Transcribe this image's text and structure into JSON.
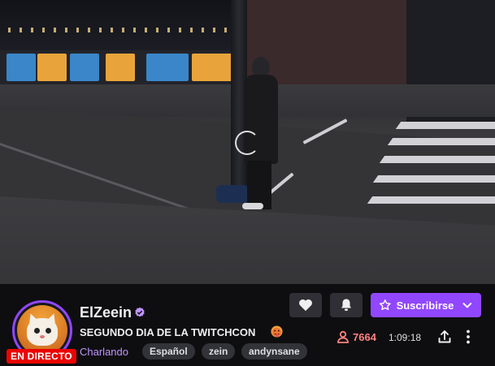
{
  "channel": {
    "name": "ElZeein",
    "verified": true,
    "title": "SEGUNDO DIA DE LA TWITCHCON",
    "title_emoji_icon": "hot-face-emoji-icon",
    "category": "Charlando",
    "tags": [
      "Español",
      "zein",
      "andynsane"
    ],
    "live_label": "EN DIRECTO"
  },
  "actions": {
    "follow_icon": "heart-icon",
    "notifications_icon": "bell-icon",
    "subscribe_label": "Suscribirse",
    "subscribe_icon": "star-icon",
    "subscribe_dropdown_icon": "chevron-down-icon",
    "share_icon": "share-icon",
    "more_icon": "more-vertical-icon"
  },
  "stats": {
    "viewers": "7664",
    "viewers_icon": "person-icon",
    "uptime": "1:09:18"
  },
  "video": {
    "loading_icon": "loading-spinner-icon"
  },
  "colors": {
    "brand": "#9147ff",
    "live": "#eb0400",
    "viewers": "#ff8280",
    "category": "#bf94ff",
    "background": "#0e0e10"
  }
}
